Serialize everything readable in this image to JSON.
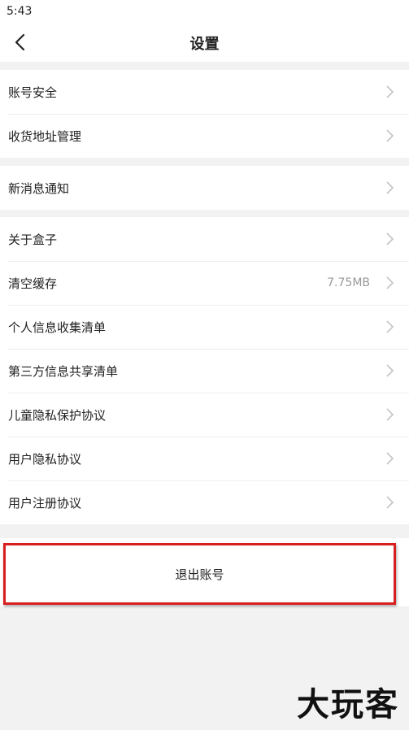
{
  "status_bar": {
    "time": "5:43"
  },
  "header": {
    "title": "设置",
    "back_icon": "chevron-left-icon"
  },
  "groups": [
    {
      "items": [
        {
          "label": "账号安全"
        },
        {
          "label": "收货地址管理"
        }
      ]
    },
    {
      "items": [
        {
          "label": "新消息通知"
        }
      ]
    },
    {
      "items": [
        {
          "label": "关于盒子"
        },
        {
          "label": "清空缓存",
          "value": "7.75MB"
        },
        {
          "label": "个人信息收集清单"
        },
        {
          "label": "第三方信息共享清单"
        },
        {
          "label": "儿童隐私保护协议"
        },
        {
          "label": "用户隐私协议"
        },
        {
          "label": "用户注册协议"
        }
      ]
    }
  ],
  "logout": {
    "label": "退出账号"
  },
  "watermark": {
    "text": "大玩客"
  },
  "colors": {
    "highlight_border": "#d81e1e",
    "background": "#f2f2f2"
  }
}
